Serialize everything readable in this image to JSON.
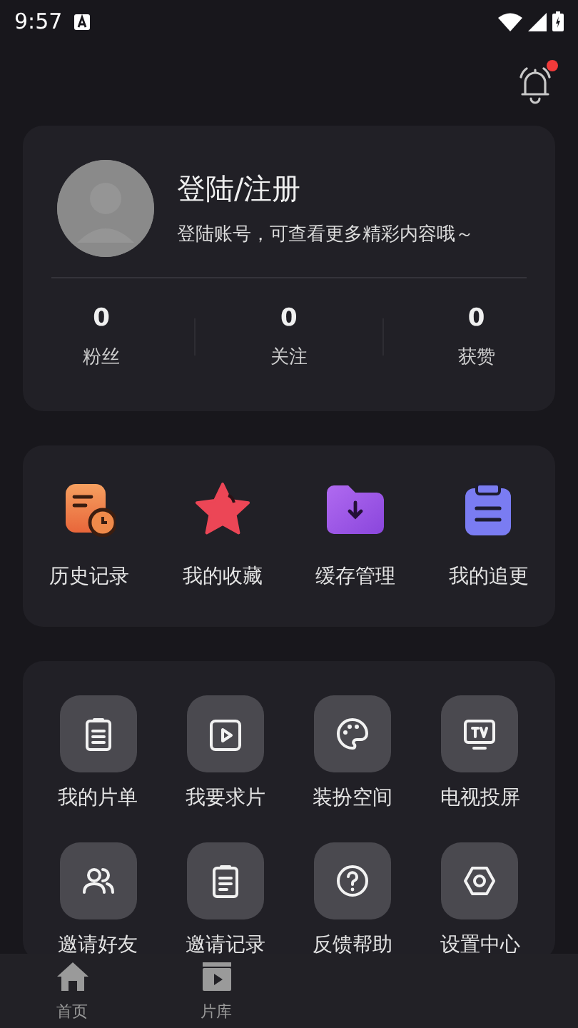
{
  "status_bar": {
    "time": "9:57"
  },
  "header": {
    "notification_dot": true
  },
  "profile": {
    "title": "登陆/注册",
    "subtitle": "登陆账号，可查看更多精彩内容哦～",
    "stats": [
      {
        "value": "0",
        "label": "粉丝"
      },
      {
        "value": "0",
        "label": "关注"
      },
      {
        "value": "0",
        "label": "获赞"
      }
    ]
  },
  "shortcuts": [
    {
      "kind": "history",
      "label": "历史记录"
    },
    {
      "kind": "favorites",
      "label": "我的收藏"
    },
    {
      "kind": "downloads",
      "label": "缓存管理"
    },
    {
      "kind": "following",
      "label": "我的追更"
    }
  ],
  "tools": [
    {
      "kind": "list",
      "label": "我的片单"
    },
    {
      "kind": "request",
      "label": "我要求片"
    },
    {
      "kind": "palette",
      "label": "装扮空间"
    },
    {
      "kind": "tv",
      "label": "电视投屏"
    },
    {
      "kind": "friends",
      "label": "邀请好友"
    },
    {
      "kind": "record",
      "label": "邀请记录"
    },
    {
      "kind": "help",
      "label": "反馈帮助"
    },
    {
      "kind": "settings",
      "label": "设置中心"
    }
  ],
  "tab_bar": [
    {
      "kind": "home",
      "label": "首页",
      "selected": false
    },
    {
      "kind": "library",
      "label": "片库",
      "selected": false
    }
  ]
}
